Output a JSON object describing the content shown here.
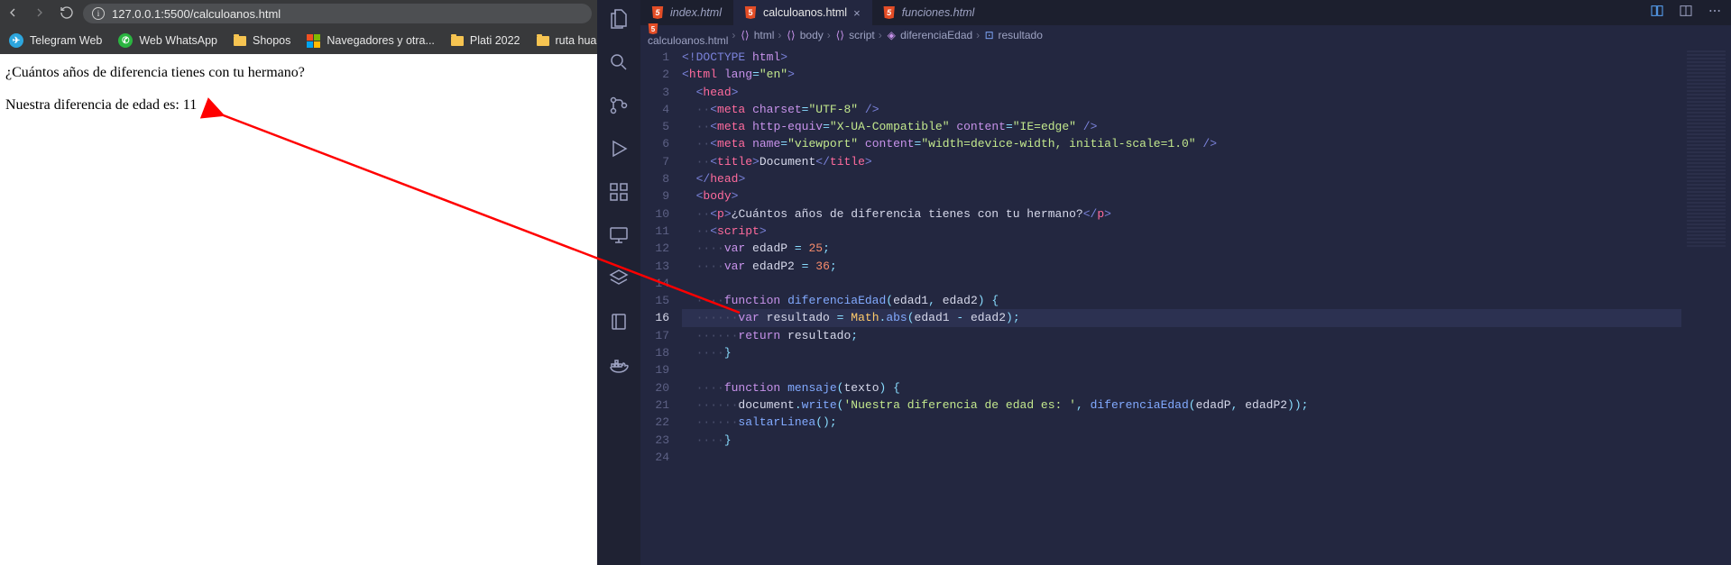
{
  "browser": {
    "url": "127.0.0.1:5500/calculoanos.html",
    "bookmarks": [
      {
        "label": "Telegram Web",
        "icon": "telegram",
        "color": "#2da6de"
      },
      {
        "label": "Web WhatsApp",
        "icon": "whatsapp",
        "color": "#2ab540"
      },
      {
        "label": "Shopos",
        "icon": "folder"
      },
      {
        "label": "Navegadores y otra...",
        "icon": "ms"
      },
      {
        "label": "Plati 2022",
        "icon": "folder"
      },
      {
        "label": "ruta hua",
        "icon": "folder"
      }
    ],
    "page": {
      "question": "¿Cuántos años de diferencia tienes con tu hermano?",
      "result": "Nuestra diferencia de edad es: 11"
    }
  },
  "vscode": {
    "tabs": [
      {
        "name": "index.html",
        "active": false
      },
      {
        "name": "calculoanos.html",
        "active": true
      },
      {
        "name": "funciones.html",
        "active": false
      }
    ],
    "breadcrumbs": [
      {
        "icon": "html5",
        "label": "calculoanos.html"
      },
      {
        "icon": "brackets",
        "label": "html"
      },
      {
        "icon": "brackets",
        "label": "body"
      },
      {
        "icon": "brackets",
        "label": "script"
      },
      {
        "icon": "cube",
        "label": "diferenciaEdad"
      },
      {
        "icon": "var",
        "label": "resultado"
      }
    ],
    "current_line": 16,
    "code_lines": [
      {
        "n": 1,
        "html": "<span class='tok-pun'>&lt;!</span><span class='tok-decl'>DOCTYPE</span> <span class='tok-attr'>html</span><span class='tok-pun'>&gt;</span>"
      },
      {
        "n": 2,
        "html": "<span class='tok-pun'>&lt;</span><span class='tok-tag'>html</span> <span class='tok-attr'>lang</span><span class='tok-op'>=</span><span class='tok-str'>\"en\"</span><span class='tok-pun'>&gt;</span>"
      },
      {
        "n": 3,
        "html": "  <span class='tok-pun'>&lt;</span><span class='tok-tag'>head</span><span class='tok-pun'>&gt;</span>"
      },
      {
        "n": 4,
        "html": "  <span class='tok-dots'>··</span><span class='tok-pun'>&lt;</span><span class='tok-tag'>meta</span> <span class='tok-attr'>charset</span><span class='tok-op'>=</span><span class='tok-str'>\"UTF-8\"</span> <span class='tok-pun'>/&gt;</span>"
      },
      {
        "n": 5,
        "html": "  <span class='tok-dots'>··</span><span class='tok-pun'>&lt;</span><span class='tok-tag'>meta</span> <span class='tok-attr'>http-equiv</span><span class='tok-op'>=</span><span class='tok-str'>\"X-UA-Compatible\"</span> <span class='tok-attr'>content</span><span class='tok-op'>=</span><span class='tok-str'>\"IE=edge\"</span> <span class='tok-pun'>/&gt;</span>"
      },
      {
        "n": 6,
        "html": "  <span class='tok-dots'>··</span><span class='tok-pun'>&lt;</span><span class='tok-tag'>meta</span> <span class='tok-attr'>name</span><span class='tok-op'>=</span><span class='tok-str'>\"viewport\"</span> <span class='tok-attr'>content</span><span class='tok-op'>=</span><span class='tok-str'>\"width=device-width, initial-scale=1.0\"</span> <span class='tok-pun'>/&gt;</span>"
      },
      {
        "n": 7,
        "html": "  <span class='tok-dots'>··</span><span class='tok-pun'>&lt;</span><span class='tok-tag'>title</span><span class='tok-pun'>&gt;</span><span class='tok-txt'>Document</span><span class='tok-pun'>&lt;/</span><span class='tok-tag'>title</span><span class='tok-pun'>&gt;</span>"
      },
      {
        "n": 8,
        "html": "  <span class='tok-pun'>&lt;/</span><span class='tok-tag'>head</span><span class='tok-pun'>&gt;</span>"
      },
      {
        "n": 9,
        "html": "  <span class='tok-pun'>&lt;</span><span class='tok-tag'>body</span><span class='tok-pun'>&gt;</span>"
      },
      {
        "n": 10,
        "html": "  <span class='tok-dots'>··</span><span class='tok-pun'>&lt;</span><span class='tok-tag'>p</span><span class='tok-pun'>&gt;</span><span class='tok-txt'>¿Cuántos años de diferencia tienes con tu hermano?</span><span class='tok-pun'>&lt;/</span><span class='tok-tag'>p</span><span class='tok-pun'>&gt;</span>"
      },
      {
        "n": 11,
        "html": "  <span class='tok-dots'>··</span><span class='tok-pun'>&lt;</span><span class='tok-tag'>script</span><span class='tok-pun'>&gt;</span>"
      },
      {
        "n": 12,
        "html": "  <span class='tok-dots'>····</span><span class='tok-kw'>var</span> <span class='tok-var'>edadP</span> <span class='tok-op'>=</span> <span class='tok-num'>25</span><span class='tok-op'>;</span>"
      },
      {
        "n": 13,
        "html": "  <span class='tok-dots'>····</span><span class='tok-kw'>var</span> <span class='tok-var'>edadP2</span> <span class='tok-op'>=</span> <span class='tok-num'>36</span><span class='tok-op'>;</span>"
      },
      {
        "n": 14,
        "html": " "
      },
      {
        "n": 15,
        "html": "  <span class='tok-dots'>····</span><span class='tok-kw'>function</span> <span class='tok-fn'>diferenciaEdad</span><span class='tok-op'>(</span><span class='tok-var'>edad1</span><span class='tok-op'>,</span> <span class='tok-var'>edad2</span><span class='tok-op'>)</span> <span class='tok-op'>{</span>"
      },
      {
        "n": 16,
        "html": "  <span class='tok-dots'>······</span><span class='tok-kw'>var</span> <span class='tok-var'>resultado</span> <span class='tok-op'>=</span> <span class='tok-cls'>Math</span><span class='tok-op'>.</span><span class='tok-fn'>abs</span><span class='tok-op'>(</span><span class='tok-var'>edad1</span> <span class='tok-op'>-</span> <span class='tok-var'>edad2</span><span class='tok-op'>);</span>"
      },
      {
        "n": 17,
        "html": "  <span class='tok-dots'>······</span><span class='tok-kw'>return</span> <span class='tok-var'>resultado</span><span class='tok-op'>;</span>"
      },
      {
        "n": 18,
        "html": "  <span class='tok-dots'>····</span><span class='tok-op'>}</span>"
      },
      {
        "n": 19,
        "html": " "
      },
      {
        "n": 20,
        "html": "  <span class='tok-dots'>····</span><span class='tok-kw'>function</span> <span class='tok-fn'>mensaje</span><span class='tok-op'>(</span><span class='tok-var'>texto</span><span class='tok-op'>)</span> <span class='tok-op'>{</span>"
      },
      {
        "n": 21,
        "html": "  <span class='tok-dots'>······</span><span class='tok-var'>document</span><span class='tok-op'>.</span><span class='tok-fn'>write</span><span class='tok-op'>(</span><span class='tok-str'>'Nuestra diferencia de edad es: '</span><span class='tok-op'>,</span> <span class='tok-fn'>diferenciaEdad</span><span class='tok-op'>(</span><span class='tok-var'>edadP</span><span class='tok-op'>,</span> <span class='tok-var'>edadP2</span><span class='tok-op'>));</span>"
      },
      {
        "n": 22,
        "html": "  <span class='tok-dots'>······</span><span class='tok-fn'>saltarLinea</span><span class='tok-op'>();</span>"
      },
      {
        "n": 23,
        "html": "  <span class='tok-dots'>····</span><span class='tok-op'>}</span>"
      },
      {
        "n": 24,
        "html": " "
      }
    ]
  }
}
